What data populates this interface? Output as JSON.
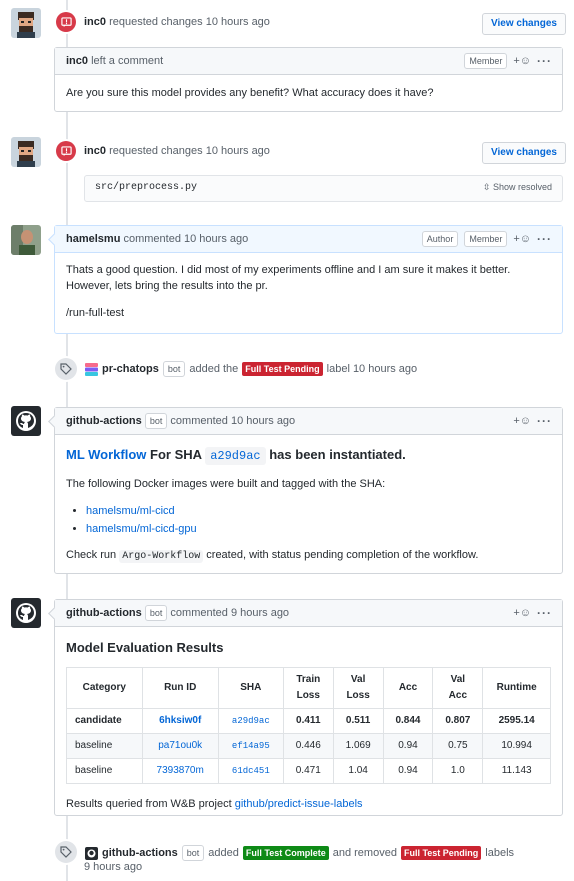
{
  "events": {
    "review1": {
      "user": "inc0",
      "action": "requested changes 10 hours ago",
      "button": "View changes"
    },
    "review2": {
      "user": "inc0",
      "action": "requested changes 10 hours ago",
      "button": "View changes"
    }
  },
  "comment_inc0": {
    "user": "inc0",
    "action": "left a comment",
    "badge": "Member",
    "body": "Are you sure this model provides any benefit? What accuracy does it have?"
  },
  "file_ref": {
    "path": "src/preprocess.py",
    "show_resolved": "Show resolved"
  },
  "comment_hamel": {
    "user": "hamelsmu",
    "action": "commented 10 hours ago",
    "badge_author": "Author",
    "badge_member": "Member",
    "line1": "Thats a good question. I did most of my experiments offline and I am sure it makes it better.",
    "line2": "However, lets bring the results into the pr.",
    "line3": "/run-full-test"
  },
  "label_event1": {
    "user": "pr-chatops",
    "bot": "bot",
    "added": "added the",
    "label": "Full Test Pending",
    "suffix": "label 10 hours ago"
  },
  "comment_gha1": {
    "user": "github-actions",
    "bot": "bot",
    "action": "commented 10 hours ago",
    "heading_link": "ML Workflow",
    "heading_mid": "For SHA",
    "heading_sha": "a29d9ac",
    "heading_end": "has been instantiated.",
    "intro": "The following Docker images were built and tagged with the SHA:",
    "images": [
      "hamelsmu/ml-cicd",
      "hamelsmu/ml-cicd-gpu"
    ],
    "check_pre": "Check run",
    "check_code": "Argo-Workflow",
    "check_post": "created, with status pending completion of the workflow."
  },
  "comment_gha2": {
    "user": "github-actions",
    "bot": "bot",
    "action": "commented 9 hours ago",
    "title": "Model Evaluation Results",
    "headers": [
      [
        "Category"
      ],
      [
        "Run ID"
      ],
      [
        "SHA"
      ],
      [
        "Train",
        "Loss"
      ],
      [
        "Val",
        "Loss"
      ],
      [
        "Acc"
      ],
      [
        "Val",
        "Acc"
      ],
      [
        "Runtime"
      ]
    ],
    "rows": [
      [
        "candidate",
        "6hksiw0f",
        "a29d9ac",
        "0.411",
        "0.511",
        "0.844",
        "0.807",
        "2595.14"
      ],
      [
        "baseline",
        "pa71ou0k",
        "ef14a95",
        "0.446",
        "1.069",
        "0.94",
        "0.75",
        "10.994"
      ],
      [
        "baseline",
        "7393870m",
        "61dc451",
        "0.471",
        "1.04",
        "0.94",
        "1.0",
        "11.143"
      ]
    ],
    "footer_pre": "Results queried from W&B project",
    "footer_link": "github/predict-issue-labels"
  },
  "label_event2": {
    "user": "github-actions",
    "bot": "bot",
    "added": "added",
    "label_added": "Full Test Complete",
    "and_removed": "and removed",
    "label_removed": "Full Test Pending",
    "suffix": "labels",
    "time": "9 hours ago"
  },
  "colors": {
    "red": "#d73a49",
    "green": "#0e8a16",
    "red_label": "#cb2431",
    "link": "#0366d6"
  }
}
